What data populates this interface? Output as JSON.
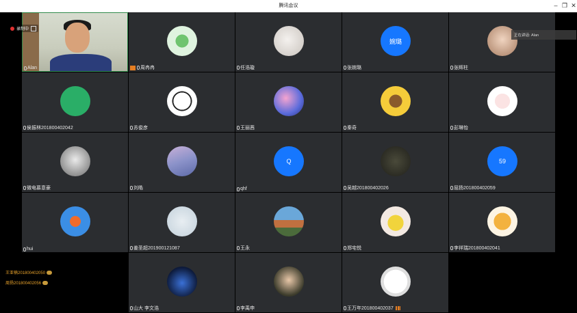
{
  "window": {
    "title": "腾讯会议"
  },
  "recording": {
    "label": "录制中"
  },
  "speaking": {
    "label": "正在讲话: Alan"
  },
  "colors": {
    "tile_bg": "#2b2d30",
    "blue_avatar": "#1677ff",
    "wechat_green": "#2aae67",
    "hand_raise": "#e8a22b"
  },
  "participants": [
    {
      "name": "Alan",
      "avatar": "camera-video",
      "mic": "on"
    },
    {
      "name": "周冉冉",
      "avatar": "clover-icon",
      "mic": "muted",
      "host": true
    },
    {
      "name": "任浩璇",
      "avatar": "white-photo",
      "mic": "muted"
    },
    {
      "name": "张婉璐",
      "avatar_text": "婉璐",
      "avatar": "blue-text",
      "mic": "muted"
    },
    {
      "name": "张辉柱",
      "avatar": "cat-photo",
      "mic": "muted"
    },
    {
      "name": "侯振林201800402042",
      "avatar": "wechat-icon",
      "mic": "muted"
    },
    {
      "name": "苏俊彦",
      "avatar": "anime-sketch",
      "mic": "muted"
    },
    {
      "name": "王丽茜",
      "avatar": "anime-colorful",
      "mic": "muted"
    },
    {
      "name": "秦奇",
      "avatar": "horse-cartoon",
      "mic": "muted"
    },
    {
      "name": "彭琳怡",
      "avatar": "sheep-cartoon",
      "mic": "muted"
    },
    {
      "name": "微电慕意豪",
      "avatar": "cat-gray",
      "mic": "muted"
    },
    {
      "name": "刘皓",
      "avatar": "sky-photo",
      "mic": "muted"
    },
    {
      "name": "qhf",
      "avatar_text": "Q",
      "avatar": "blue-text",
      "mic": "muted"
    },
    {
      "name": "吴越201800402026",
      "avatar": "person-dark",
      "mic": "muted"
    },
    {
      "name": "屈扬201800402059",
      "avatar_text": "59",
      "avatar": "blue-text",
      "mic": "muted"
    },
    {
      "name": "hui",
      "avatar": "candy-icon",
      "mic": "muted"
    },
    {
      "name": "姜圣超201900121087",
      "avatar": "sketch-photo",
      "mic": "muted"
    },
    {
      "name": "王永",
      "avatar": "landscape-photo",
      "mic": "muted"
    },
    {
      "name": "郑宅悦",
      "avatar": "person-yellow",
      "mic": "muted"
    },
    {
      "name": "李祥瑞201800402041",
      "avatar": "face-cartoon",
      "mic": "muted"
    },
    {
      "name": "山大 李文浩",
      "avatar": "night-scene",
      "mic": "muted"
    },
    {
      "name": "李禹申",
      "avatar": "kid-photo",
      "mic": "muted"
    },
    {
      "name": "王万年201800402037",
      "avatar": "girl-drawing",
      "mic": "muted",
      "signal": true
    }
  ],
  "side_list": [
    {
      "name": "王亚楠201800402050"
    },
    {
      "name": "周扬201800402056"
    }
  ]
}
